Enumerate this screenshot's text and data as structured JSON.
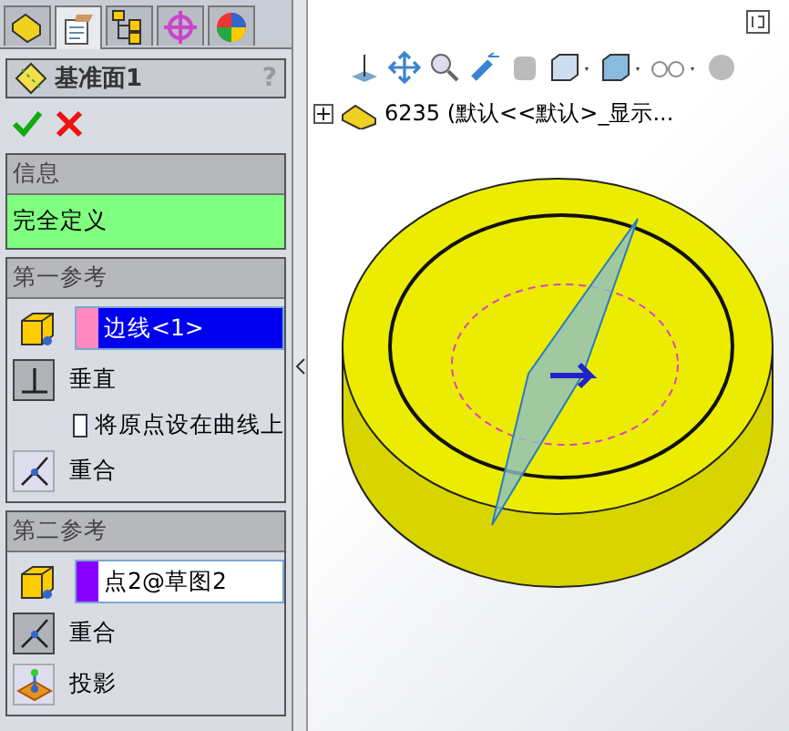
{
  "tabs": [
    {
      "selected": false
    },
    {
      "selected": true
    },
    {
      "selected": false
    },
    {
      "selected": false
    },
    {
      "selected": false
    }
  ],
  "panel": {
    "title": "基准面1",
    "help": "?"
  },
  "info": {
    "header": "信息",
    "message": "完全定义"
  },
  "first_reference": {
    "header": "第一参考",
    "selection": {
      "value": "边线<1>",
      "color": "#ff88c0",
      "selected": true
    },
    "options": [
      {
        "kind": "perpendicular",
        "label": "垂直",
        "selected": true
      },
      {
        "kind": "checkbox",
        "label": "将原点设在曲线上",
        "checked": false
      },
      {
        "kind": "coincident",
        "label": "重合",
        "selected": false
      }
    ]
  },
  "second_reference": {
    "header": "第二参考",
    "selection": {
      "value": "点2@草图2",
      "color": "#8800ff",
      "selected": false
    },
    "options": [
      {
        "kind": "coincident",
        "label": "重合",
        "selected": true
      },
      {
        "kind": "projection",
        "label": "投影",
        "selected": false
      }
    ]
  },
  "tree": {
    "expanded": false,
    "label": "6235 (默认<<默认>_显示..."
  }
}
